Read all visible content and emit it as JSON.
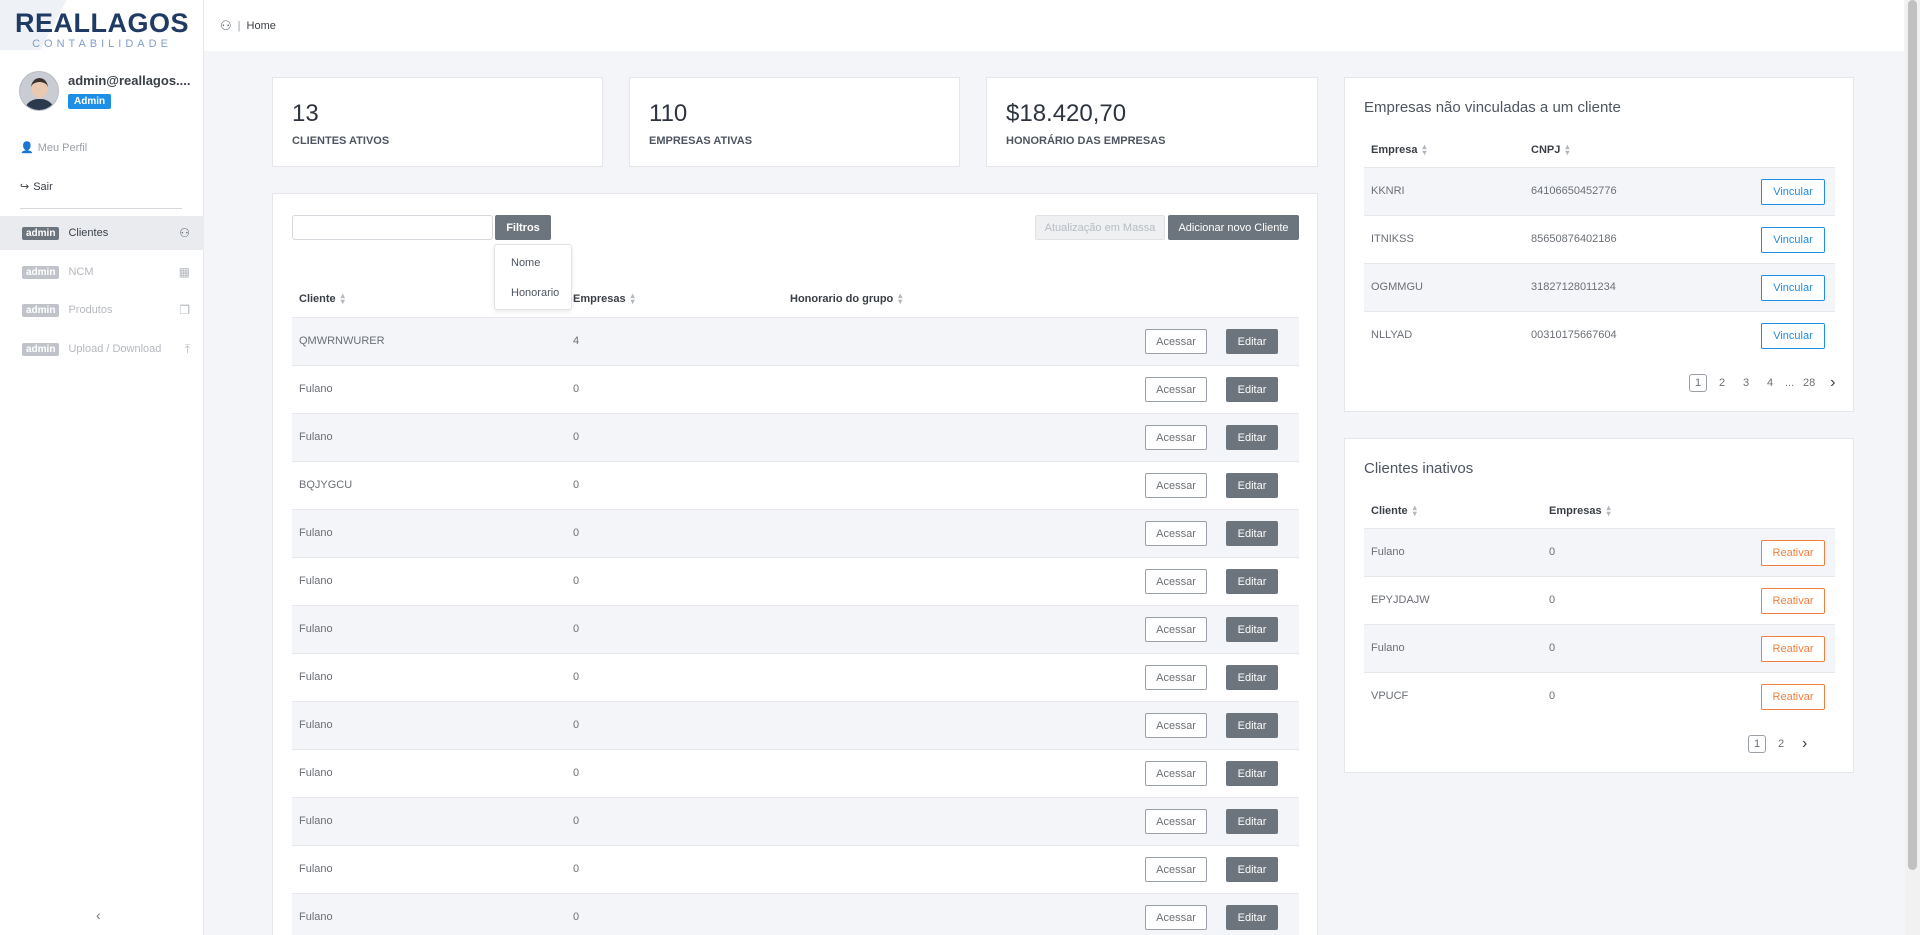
{
  "brand": {
    "name": "REALLAGOS",
    "sub": "CONTABILIDADE"
  },
  "user": {
    "email": "admin@reallagos....",
    "role": "Admin"
  },
  "sidebar": {
    "links": [
      {
        "label": "Meu Perfil"
      },
      {
        "label": "Sair"
      }
    ],
    "nav": [
      {
        "badge": "admin",
        "label": "Clientes"
      },
      {
        "badge": "admin",
        "label": "NCM"
      },
      {
        "badge": "admin",
        "label": "Produtos"
      },
      {
        "badge": "admin",
        "label": "Upload / Download"
      }
    ],
    "collapse": "‹"
  },
  "topbar": {
    "sep": "|",
    "crumb": "Home"
  },
  "stats": [
    {
      "value": "13",
      "label": "CLIENTES ATIVOS"
    },
    {
      "value": "110",
      "label": "EMPRESAS ATIVAS"
    },
    {
      "value": "$18.420,70",
      "label": "HONORÁRIO DAS EMPRESAS"
    }
  ],
  "clients": {
    "search": {
      "placeholder": "",
      "value": ""
    },
    "filter_label": "Filtros",
    "filter_options": [
      "Nome",
      "Honorario"
    ],
    "bulk_update_label": "Atualização em Massa",
    "add_label": "Adicionar novo Cliente",
    "headers": [
      "Cliente",
      "Empresas",
      "Honorario do grupo"
    ],
    "access_label": "Acessar",
    "edit_label": "Editar",
    "rows": [
      {
        "name": "QMWRNWURER",
        "companies": "4"
      },
      {
        "name": "Fulano",
        "companies": "0"
      },
      {
        "name": "Fulano",
        "companies": "0"
      },
      {
        "name": "BQJYGCU",
        "companies": "0"
      },
      {
        "name": "Fulano",
        "companies": "0"
      },
      {
        "name": "Fulano",
        "companies": "0"
      },
      {
        "name": "Fulano",
        "companies": "0"
      },
      {
        "name": "Fulano",
        "companies": "0"
      },
      {
        "name": "Fulano",
        "companies": "0"
      },
      {
        "name": "Fulano",
        "companies": "0"
      },
      {
        "name": "Fulano",
        "companies": "0"
      },
      {
        "name": "Fulano",
        "companies": "0"
      },
      {
        "name": "Fulano",
        "companies": "0"
      }
    ]
  },
  "unlinked": {
    "title": "Empresas não vinculadas a um cliente",
    "headers": [
      "Empresa",
      "CNPJ"
    ],
    "action_label": "Vincular",
    "rows": [
      {
        "name": "KKNRI",
        "cnpj": "64106650452776"
      },
      {
        "name": "ITNIKSS",
        "cnpj": "85650876402186"
      },
      {
        "name": "OGMMGU",
        "cnpj": "31827128011234"
      },
      {
        "name": "NLLYAD",
        "cnpj": "00310175667604"
      }
    ],
    "pages": [
      "1",
      "2",
      "3",
      "4",
      "...",
      "28"
    ],
    "next": "›"
  },
  "inactive": {
    "title": "Clientes inativos",
    "headers": [
      "Cliente",
      "Empresas"
    ],
    "action_label": "Reativar",
    "rows": [
      {
        "name": "Fulano",
        "companies": "0"
      },
      {
        "name": "EPYJDAJW",
        "companies": "0"
      },
      {
        "name": "Fulano",
        "companies": "0"
      },
      {
        "name": "VPUCF",
        "companies": "0"
      }
    ],
    "pages": [
      "1",
      "2"
    ],
    "next": "›"
  },
  "colors": {
    "accent_blue": "#1e8fe6",
    "accent_orange": "#f07f3e",
    "button_dark": "#6c757d",
    "brand": "#1f3b63"
  }
}
